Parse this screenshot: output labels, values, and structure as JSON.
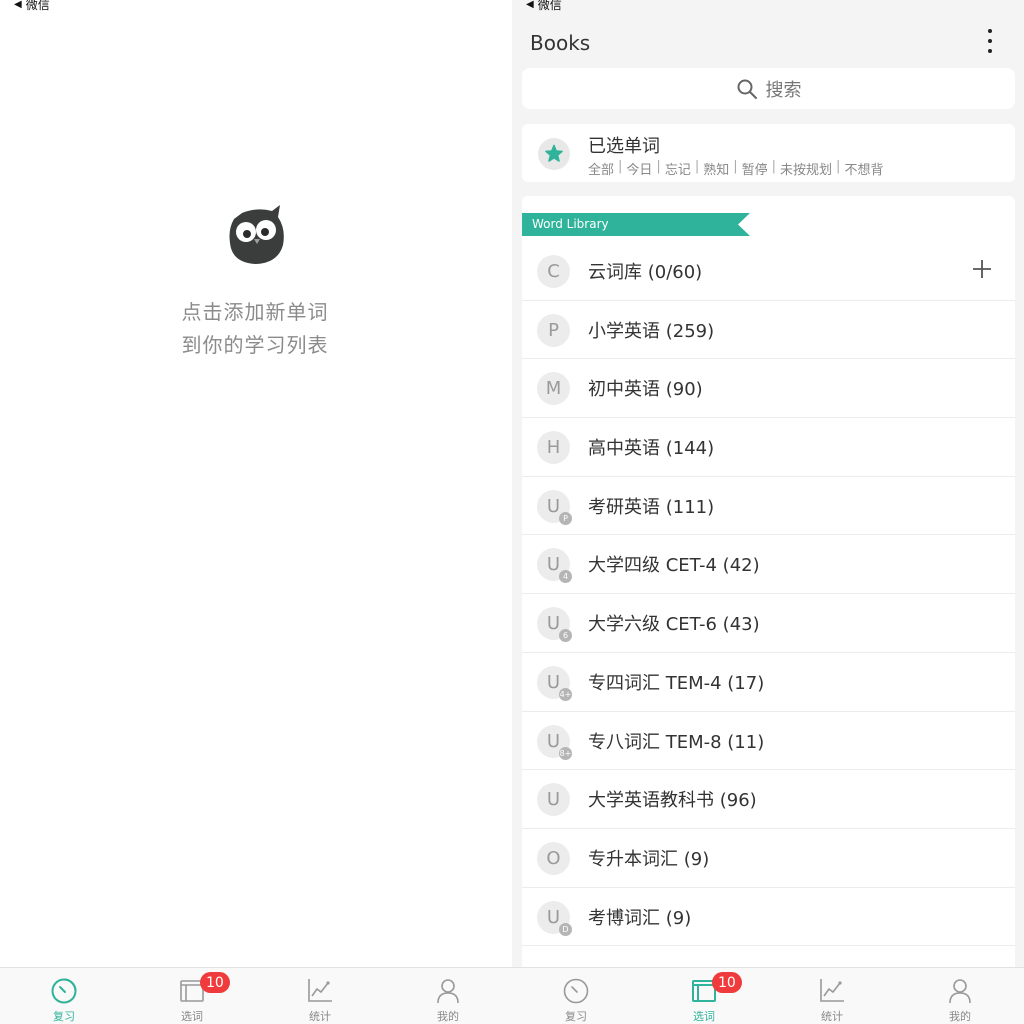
{
  "status_bar": {
    "back_label": "微信"
  },
  "review_screen": {
    "empty_line1": "点击添加新单词",
    "empty_line2": "到你的学习列表"
  },
  "books_screen": {
    "title": "Books",
    "search_placeholder": "搜索",
    "selected_words": {
      "title": "已选单词",
      "filters": [
        "全部",
        "今日",
        "忘记",
        "熟知",
        "暂停",
        "未按规划",
        "不想背"
      ]
    },
    "library_ribbon": "Word Library",
    "libraries": [
      {
        "letter": "C",
        "sub": "",
        "name": "云词库 (0/60)"
      },
      {
        "letter": "P",
        "sub": "",
        "name": "小学英语 (259)"
      },
      {
        "letter": "M",
        "sub": "",
        "name": "初中英语 (90)"
      },
      {
        "letter": "H",
        "sub": "",
        "name": "高中英语 (144)"
      },
      {
        "letter": "U",
        "sub": "P",
        "name": "考研英语 (111)"
      },
      {
        "letter": "U",
        "sub": "4",
        "name": "大学四级 CET-4 (42)"
      },
      {
        "letter": "U",
        "sub": "6",
        "name": "大学六级 CET-6 (43)"
      },
      {
        "letter": "U",
        "sub": "4+",
        "name": "专四词汇 TEM-4 (17)"
      },
      {
        "letter": "U",
        "sub": "8+",
        "name": "专八词汇 TEM-8 (11)"
      },
      {
        "letter": "U",
        "sub": "",
        "name": "大学英语教科书 (96)"
      },
      {
        "letter": "O",
        "sub": "",
        "name": "专升本词汇 (9)"
      },
      {
        "letter": "U",
        "sub": "D",
        "name": "考博词汇 (9)"
      }
    ]
  },
  "tabbar": {
    "review": "复习",
    "select": "选词",
    "stats": "统计",
    "mine": "我的",
    "select_badge": "10"
  },
  "colors": {
    "accent": "#2fb39a",
    "badge": "#ef3b3b"
  }
}
